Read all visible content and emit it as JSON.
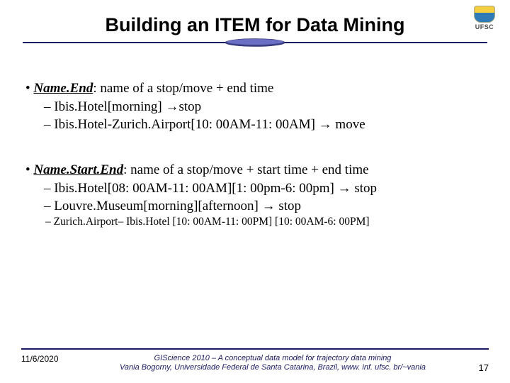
{
  "logo_text": "UFSC",
  "title": "Building an ITEM for Data Mining",
  "section1": {
    "term": "Name.End",
    "rest": ":  name of a stop/move + end time",
    "line1": "Ibis.Hotel[morning]                                  →stop",
    "line2": "Ibis.Hotel-Zurich.Airport[10: 00AM-11: 00AM]       → move"
  },
  "section2": {
    "term": "Name.Start.End",
    "rest": ":  name of a stop/move + start time + end time",
    "line1": "Ibis.Hotel[08: 00AM-11: 00AM][1: 00pm-6: 00pm]    → stop",
    "line2": "Louvre.Museum[morning][afternoon]           → stop",
    "line3": "Zurich.Airport– Ibis.Hotel [10: 00AM-11: 00PM] [10: 00AM-6: 00PM]"
  },
  "footer": {
    "date": "11/6/2020",
    "credit1": "GIScience 2010 – A conceptual data model for trajectory data mining",
    "credit2": "Vania Bogorny, Universidade Federal de Santa Catarina, Brazil, www. inf. ufsc. br/~vania",
    "page": "17"
  }
}
